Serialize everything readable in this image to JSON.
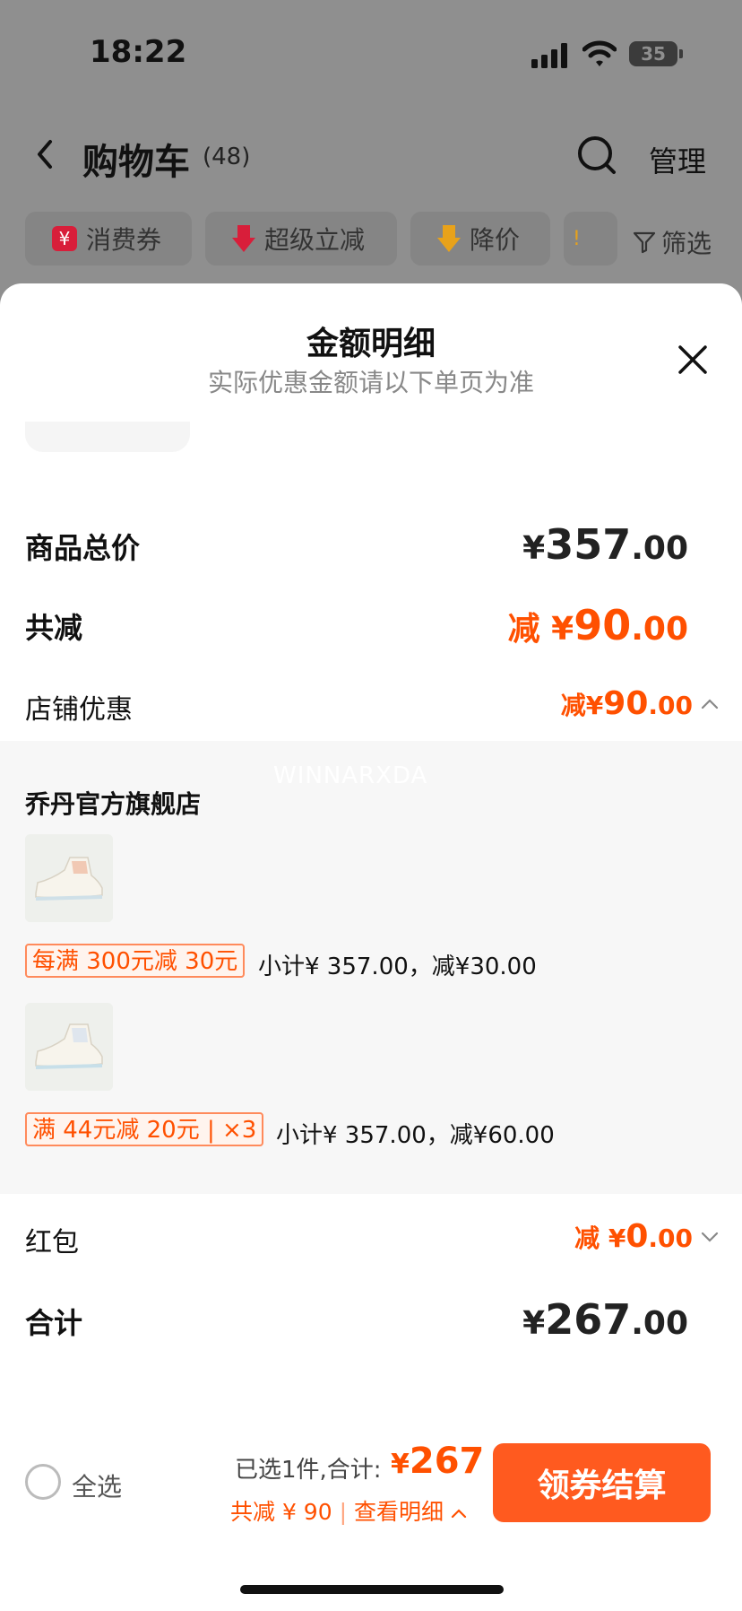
{
  "status_bar": {
    "time": "18:22",
    "battery": "35"
  },
  "header": {
    "title": "购物车",
    "count": "(48)",
    "manage": "管理"
  },
  "filters": {
    "chips": [
      {
        "label": "消费券",
        "icon": "coupon-icon",
        "color": "#d81e3a"
      },
      {
        "label": "超级立减",
        "icon": "down-arrow-icon",
        "color": "#d81e3a"
      },
      {
        "label": "降价",
        "icon": "price-drop-icon",
        "color": "#e8a21a"
      }
    ],
    "filter_label": "筛选"
  },
  "sheet": {
    "title": "金额明细",
    "subtitle": "实际优惠金额请以下单页为准",
    "goods_total": {
      "label": "商品总价",
      "currency": "¥",
      "int": "357",
      "dec": ".00"
    },
    "total_discount": {
      "label": "共减",
      "prefix": "减 ¥",
      "int": "90",
      "dec": ".00"
    },
    "store_discount": {
      "label": "店铺优惠",
      "prefix": "减¥",
      "int": "90",
      "dec": ".00"
    },
    "store": {
      "watermark": "WINNARXDA",
      "name": "乔丹官方旗舰店",
      "items": [
        {
          "thumb_icon": "sneaker-icon",
          "tag": "每满 300元减 30元",
          "subtotal": "小计¥ 357.00，减¥30.00"
        },
        {
          "thumb_icon": "sneaker-icon",
          "tag": "满 44元减 20元 | ×3",
          "subtotal": "小计¥ 357.00，减¥60.00"
        }
      ]
    },
    "red_packet": {
      "label": "红包",
      "prefix": "减 ¥",
      "int": "0",
      "dec": ".00"
    },
    "total": {
      "label": "合计",
      "currency": "¥",
      "int": "267",
      "dec": ".00"
    }
  },
  "bottom_bar": {
    "select_all": "全选",
    "selected_info": "已选1件,合计:",
    "price_currency": "¥",
    "price": "267",
    "saving": "共减 ¥ 90",
    "detail_link": "查看明细",
    "checkout": "领券结算"
  },
  "colors": {
    "accent": "#ff5000",
    "button": "#ff5a1f"
  }
}
